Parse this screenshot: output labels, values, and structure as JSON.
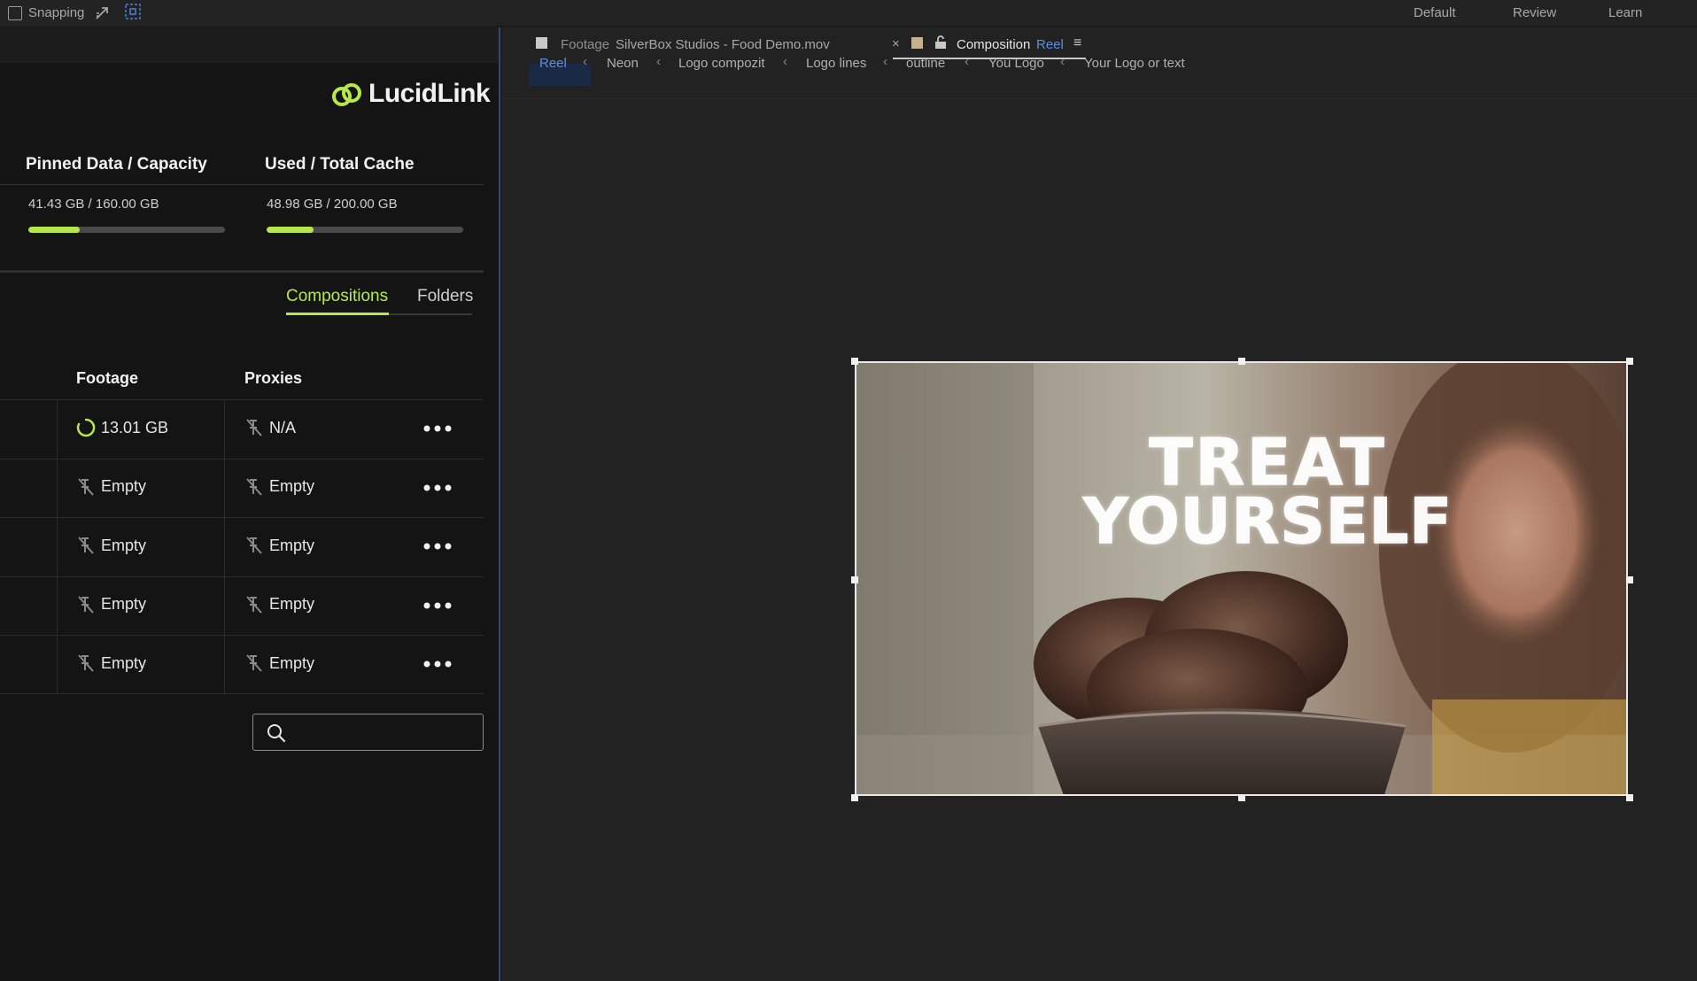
{
  "topbar": {
    "snapping_label": "Snapping",
    "workspaces": [
      "Default",
      "Review",
      "Learn"
    ]
  },
  "panel": {
    "logo_text": "LucidLink",
    "brand_color": "#b5e94b",
    "stats": [
      {
        "title": "Pinned Data / Capacity",
        "value": "41.43 GB / 160.00 GB",
        "fill": 0.26
      },
      {
        "title": "Used / Total Cache",
        "value": "48.98 GB / 200.00 GB",
        "fill": 0.24
      }
    ],
    "tabs": [
      {
        "label": "Compositions",
        "active": true
      },
      {
        "label": "Folders",
        "active": false
      }
    ],
    "columns": [
      "Footage",
      "Proxies"
    ],
    "rows": [
      {
        "footage": "13.01 GB",
        "footage_icon": "loading-ring-icon",
        "proxies": "N/A",
        "proxies_icon": "unpin-icon"
      },
      {
        "footage": "Empty",
        "footage_icon": "unpin-icon",
        "proxies": "Empty",
        "proxies_icon": "unpin-icon"
      },
      {
        "footage": "Empty",
        "footage_icon": "unpin-icon",
        "proxies": "Empty",
        "proxies_icon": "unpin-icon"
      },
      {
        "footage": "Empty",
        "footage_icon": "unpin-icon",
        "proxies": "Empty",
        "proxies_icon": "unpin-icon"
      },
      {
        "footage": "Empty",
        "footage_icon": "unpin-icon",
        "proxies": "Empty",
        "proxies_icon": "unpin-icon"
      }
    ],
    "search": {
      "placeholder": "",
      "icon": "search-icon"
    }
  },
  "viewer_tabs": {
    "footage_label": "Footage",
    "footage_name": "SilverBox Studios - Food Demo.mov",
    "close_glyph": "×",
    "composition_label": "Composition",
    "composition_name": "Reel",
    "menu_glyph": "≡"
  },
  "breadcrumbs": [
    "Reel",
    "Neon",
    "Logo compozit",
    "Logo lines",
    "outline",
    "You Logo",
    "Your Logo or text"
  ],
  "frame": {
    "line1": "TREAT",
    "line2": "YOURSELF"
  }
}
